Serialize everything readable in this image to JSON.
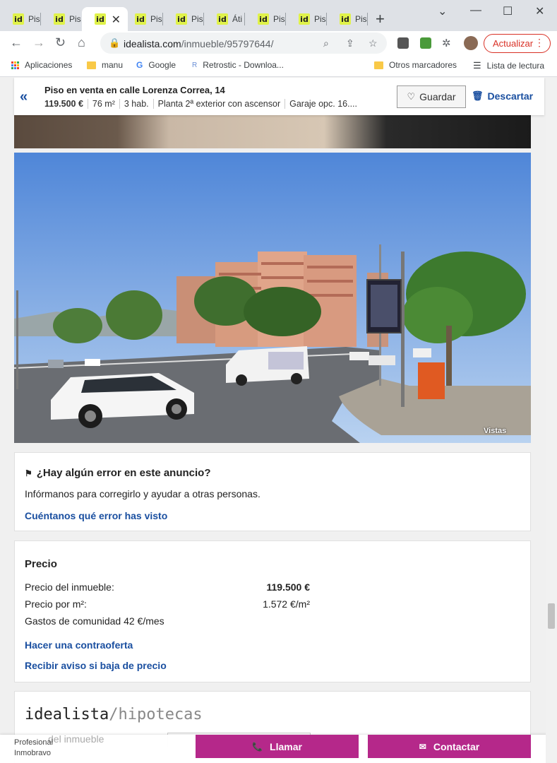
{
  "browser": {
    "tabs": [
      {
        "label": "Pis",
        "favicon": "id"
      },
      {
        "label": "Pis",
        "favicon": "id"
      },
      {
        "label": "",
        "favicon": "id",
        "active": true
      },
      {
        "label": "Pis",
        "favicon": "id"
      },
      {
        "label": "Pis",
        "favicon": "id"
      },
      {
        "label": "Áti",
        "favicon": "id"
      },
      {
        "label": "Pis",
        "favicon": "id"
      },
      {
        "label": "Pis",
        "favicon": "id"
      },
      {
        "label": "Pis",
        "favicon": "id"
      }
    ],
    "url_domain": "idealista.com",
    "url_path": "/inmueble/95797644/",
    "update_label": "Actualizar",
    "accent_color": "#d93025"
  },
  "bookmarks": {
    "apps": "Aplicaciones",
    "items": [
      "manu",
      "Google",
      "Retrostic - Downloa..."
    ],
    "other": "Otros marcadores",
    "reading": "Lista de lectura"
  },
  "listing": {
    "title": "Piso en venta en calle Lorenza Correa, 14",
    "price": "119.500 €",
    "area": "76 m²",
    "rooms": "3 hab.",
    "floor": "Planta 2ª exterior con ascensor",
    "garage": "Garaje opc. 16....",
    "save_label": "Guardar",
    "discard_label": "Descartar"
  },
  "photo": {
    "caption": "Vistas"
  },
  "error_card": {
    "heading": "¿Hay algún error en este anuncio?",
    "text": "Infórmanos para corregirlo y ayudar a otras personas.",
    "link": "Cuéntanos qué error has visto"
  },
  "price_card": {
    "heading": "Precio",
    "rows": [
      {
        "label": "Precio del inmueble:",
        "value": "119.500 €"
      },
      {
        "label": "Precio por m²:",
        "value": "1.572 €/m²"
      }
    ],
    "community": "Gastos de comunidad 42 €/mes",
    "counteroffer": "Hacer una contraoferta",
    "alert": "Recibir aviso si baja de precio"
  },
  "mortgage": {
    "brand": "idealista",
    "suffix": "hipotecas",
    "ghost_label": "del inmueble"
  },
  "contact_bar": {
    "profesional": "Profesional",
    "agency": "Inmobravo",
    "call_label": "Llamar",
    "contact_label": "Contactar",
    "brand_color": "#b5288a"
  }
}
